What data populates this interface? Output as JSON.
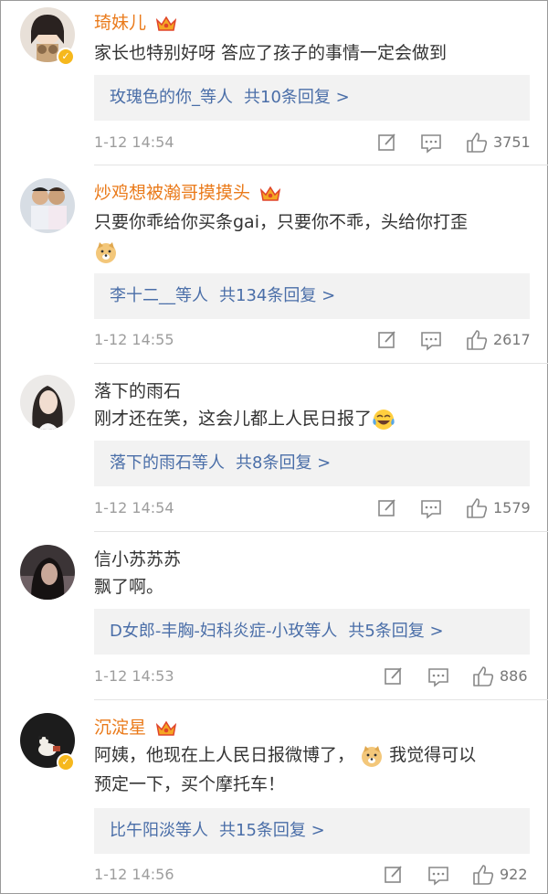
{
  "comments": [
    {
      "user": "琦妹儿",
      "content": "家长也特别好呀 答应了孩子的事情一定会做到",
      "reply_users": "玫瑰色的你_等人",
      "reply_count": "共10条回复 >",
      "time": "1-12 14:54",
      "likes": "3751"
    },
    {
      "user": "炒鸡想被瀚哥摸摸头",
      "content": "只要你乖给你买条gai，只要你不乖，头给你打歪",
      "reply_users": "李十二__等人",
      "reply_count": "共134条回复 >",
      "time": "1-12 14:55",
      "likes": "2617"
    },
    {
      "user": "落下的雨石",
      "content": "刚才还在笑，这会儿都上人民日报了",
      "reply_users": "落下的雨石等人",
      "reply_count": "共8条回复 >",
      "time": "1-12 14:54",
      "likes": "1579"
    },
    {
      "user": "信小苏苏苏",
      "content": "飘了啊。",
      "reply_users": "D女郎-丰胸-妇科炎症-小玫等人",
      "reply_count": "共5条回复 >",
      "time": "1-12 14:53",
      "likes": "886"
    },
    {
      "user": "沉淀星",
      "content_a": "阿姨，他现在上人民日报微博了，",
      "content_b": "我觉得可以",
      "content_c": "预定一下，买个摩托车！",
      "reply_users": "比午阳淡等人",
      "reply_count": "共15条回复 >",
      "time": "1-12 14:56",
      "likes": "922"
    }
  ],
  "icons": {
    "edit": "edit-icon",
    "comment": "comment-icon",
    "like": "thumbs-up-icon",
    "vip": "crown-icon",
    "verified": "verified-badge-icon"
  },
  "colors": {
    "vip_name": "#ea7a1a",
    "reply_link": "#4a6ea8",
    "reply_bg": "#f2f2f2",
    "meta_text": "#9d9d9d"
  }
}
